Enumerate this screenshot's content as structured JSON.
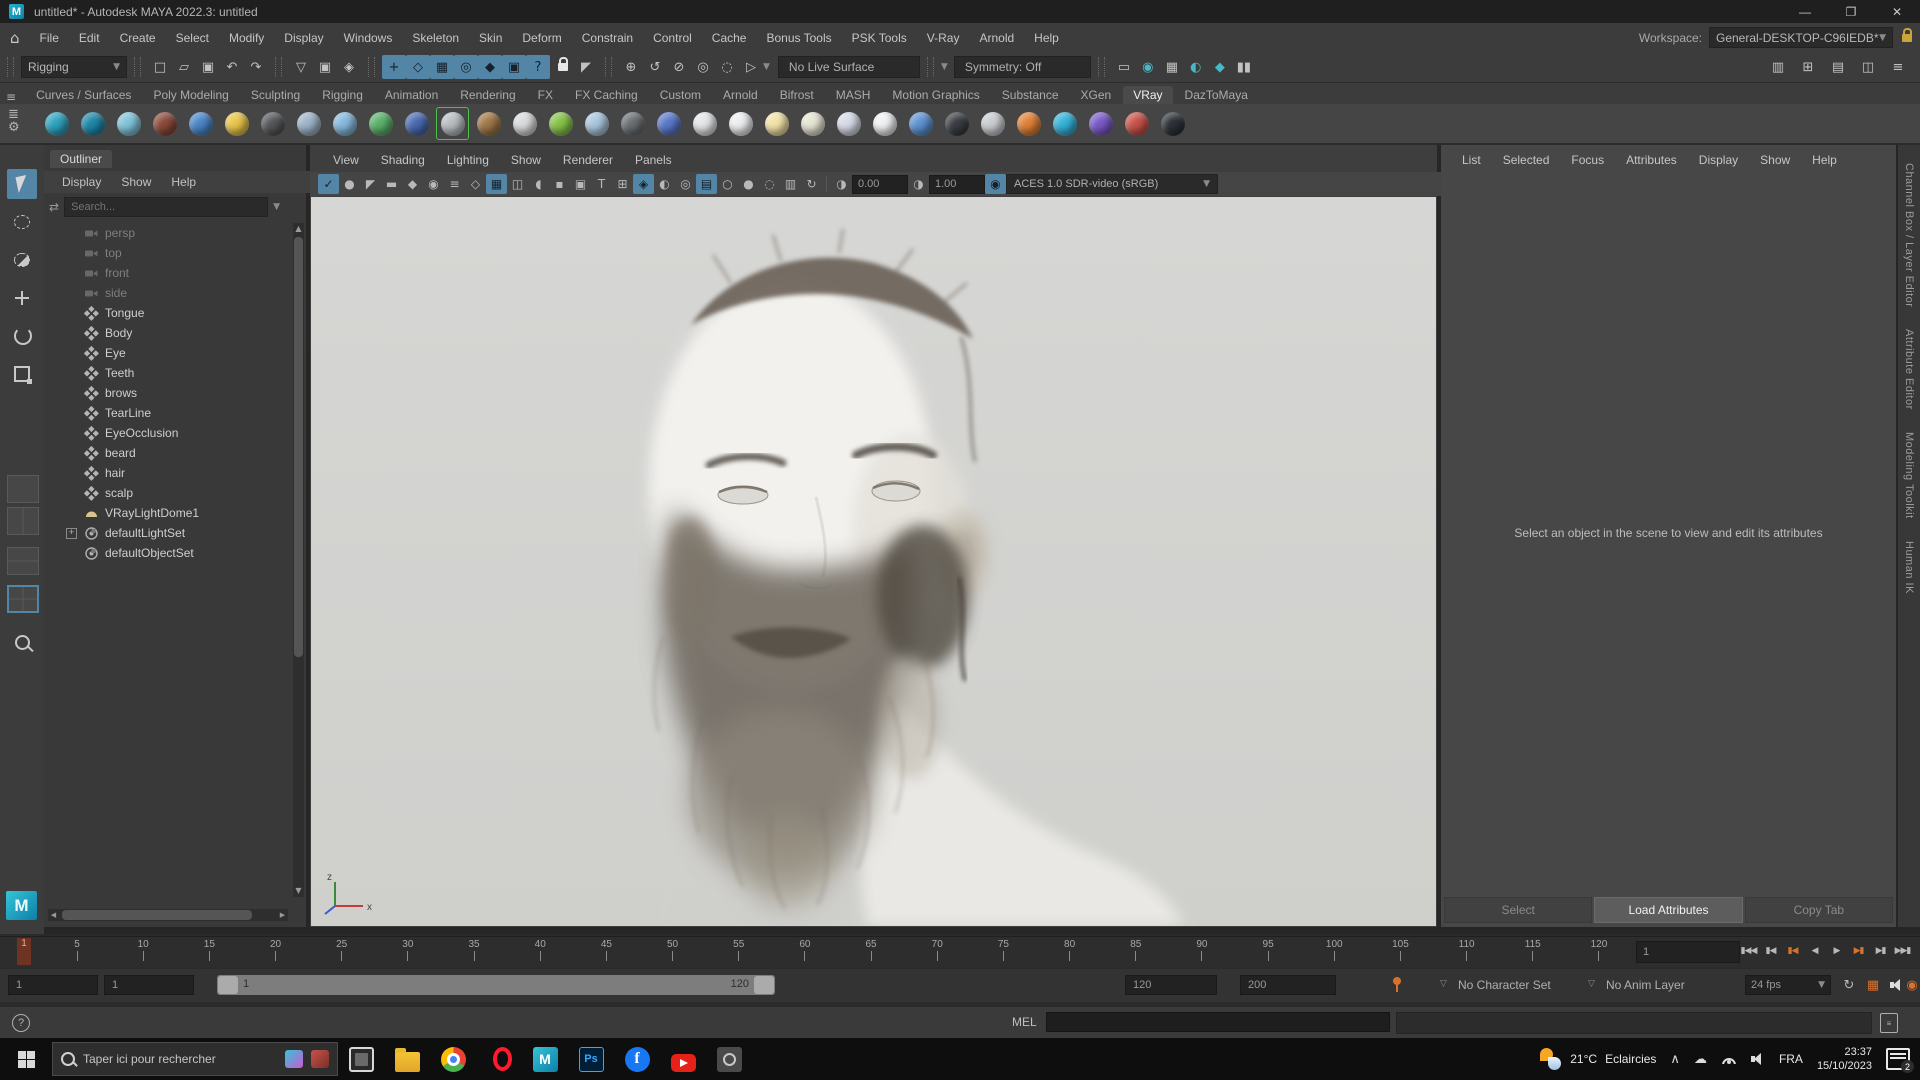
{
  "window": {
    "title": "untitled* - Autodesk MAYA 2022.3: untitled"
  },
  "menu_bar": {
    "items": [
      "File",
      "Edit",
      "Create",
      "Select",
      "Modify",
      "Display",
      "Windows",
      "Skeleton",
      "Skin",
      "Deform",
      "Constrain",
      "Control",
      "Cache",
      "Bonus Tools",
      "PSK Tools",
      "V-Ray",
      "Arnold",
      "Help"
    ],
    "workspace_label": "Workspace:",
    "workspace_value": "General-DESKTOP-C96IEDB*"
  },
  "status_line": {
    "menuset": "Rigging",
    "file_icons": [
      {
        "g": "□",
        "name": "new-scene-icon"
      },
      {
        "g": "▱",
        "name": "open-scene-icon"
      },
      {
        "g": "▣",
        "name": "save-scene-icon"
      },
      {
        "g": "↶",
        "name": "undo-icon"
      },
      {
        "g": "↷",
        "name": "redo-icon"
      }
    ],
    "selection_icons": [
      {
        "g": "▽",
        "name": "select-hierarchy-icon"
      },
      {
        "g": "▣",
        "name": "select-object-icon",
        "on": true
      },
      {
        "g": "◈",
        "name": "select-component-icon"
      }
    ],
    "snap_icons": [
      {
        "g": "+",
        "on": true
      },
      {
        "g": "◇",
        "on": true
      },
      {
        "g": "▦",
        "on": true
      },
      {
        "g": "◎",
        "on": true
      },
      {
        "g": "◆",
        "on": true
      },
      {
        "g": "▣",
        "on": true
      },
      {
        "g": "?",
        "on": true
      }
    ],
    "history_icons": [
      {
        "g": "⊕"
      },
      {
        "g": "↺"
      },
      {
        "g": "⊘"
      },
      {
        "g": "◎"
      },
      {
        "g": "◌"
      },
      {
        "g": "▷"
      }
    ],
    "live_surface": "No Live Surface",
    "symmetry": "Symmetry: Off",
    "render_icons": [
      {
        "g": "▭"
      },
      {
        "g": "◉",
        "teal": true
      },
      {
        "g": "▦"
      },
      {
        "g": "◐",
        "teal": true
      },
      {
        "g": "◆",
        "teal": true
      },
      {
        "g": "▮▮"
      }
    ],
    "sidebar_toggles": [
      {
        "g": "▥"
      },
      {
        "g": "⊞"
      },
      {
        "g": "▤",
        "on": true
      },
      {
        "g": "◫"
      },
      {
        "g": "≡"
      }
    ]
  },
  "shelf": {
    "tabs": [
      {
        "label": "Curves / Surfaces"
      },
      {
        "label": "Poly Modeling"
      },
      {
        "label": "Sculpting"
      },
      {
        "label": "Rigging"
      },
      {
        "label": "Animation"
      },
      {
        "label": "Rendering"
      },
      {
        "label": "FX"
      },
      {
        "label": "FX Caching"
      },
      {
        "label": "Custom"
      },
      {
        "label": "Arnold"
      },
      {
        "label": "Bifrost"
      },
      {
        "label": "MASH"
      },
      {
        "label": "Motion Graphics"
      },
      {
        "label": "Substance"
      },
      {
        "label": "XGen"
      },
      {
        "label": "VRay",
        "active": true
      },
      {
        "label": "DazToMaya"
      }
    ],
    "icons": [
      {
        "name": "vray-node-icon",
        "color": "#2fa3c0"
      },
      {
        "name": "vray-nodes-icon",
        "color": "#1f87a8"
      },
      {
        "name": "vray-panel-icon",
        "color": "#7fc3d8"
      },
      {
        "name": "vray-cube-icon",
        "color": "#8a4a3a"
      },
      {
        "name": "vray-sphere-icon",
        "color": "#4a86c8"
      },
      {
        "name": "vray-lightbulb-icon",
        "color": "#e8c44a"
      },
      {
        "name": "vray-frame-icon",
        "color": "#55575a"
      },
      {
        "name": "vray-gray-sphere-icon",
        "color": "#9db3c8"
      },
      {
        "name": "vray-dome-light-icon",
        "color": "#86b8dc"
      },
      {
        "name": "vray-ies-light-icon",
        "color": "#5ab06a"
      },
      {
        "name": "vray-mesh-light-icon",
        "color": "#4a6ab0"
      },
      {
        "name": "vray-selected-sphere-icon",
        "color": "#b9bdc0",
        "sel": true
      },
      {
        "name": "vray-wood-box-icon",
        "color": "#a07848"
      },
      {
        "name": "vray-wire-sphere-icon",
        "color": "#d8dadc"
      },
      {
        "name": "vray-grass-icon",
        "color": "#86c24a"
      },
      {
        "name": "vray-fur-sphere-icon",
        "color": "#a9c6de"
      },
      {
        "name": "vray-question-icon",
        "color": "#6a6e72"
      },
      {
        "name": "vray-blob-icon",
        "color": "#5a78c8"
      },
      {
        "name": "vray-plane-icon",
        "color": "#e4e6e8"
      },
      {
        "name": "vray-arrow-icon",
        "color": "#eceef0"
      },
      {
        "name": "vray-sun-icon",
        "color": "#f2e2a8"
      },
      {
        "name": "vray-rays-icon",
        "color": "#e6e4d2"
      },
      {
        "name": "vray-fog-icon",
        "color": "#d6dae6"
      },
      {
        "name": "vray-page-icon",
        "color": "#eff1f3"
      },
      {
        "name": "vray-drop-icon",
        "color": "#5e92d2"
      },
      {
        "name": "vray-multi-icon",
        "color": "#3a3e44"
      },
      {
        "name": "vray-checker-icon",
        "color": "#c9ccd0"
      },
      {
        "name": "vray-clipboard-icon",
        "color": "#e08038"
      },
      {
        "name": "vray-monitor-icon",
        "color": "#35b2d9"
      },
      {
        "name": "vray-purple-icon",
        "color": "#7a5ac8"
      },
      {
        "name": "vray-pair-icon",
        "color": "#c8524a"
      },
      {
        "name": "vray-dark-sphere-icon",
        "color": "#2e3238"
      }
    ]
  },
  "toolbox": {
    "tools": [
      {
        "icon": "select",
        "name": "select-tool",
        "active": true
      },
      {
        "icon": "lasso",
        "name": "lasso-tool"
      },
      {
        "icon": "paintsel",
        "name": "paint-select-tool"
      },
      {
        "icon": "move",
        "name": "move-tool"
      },
      {
        "icon": "rotate",
        "name": "rotate-tool"
      },
      {
        "icon": "scale",
        "name": "scale-tool"
      }
    ]
  },
  "outliner": {
    "tab": "Outliner",
    "menus": [
      "Display",
      "Show",
      "Help"
    ],
    "search_placeholder": "Search...",
    "items": [
      {
        "label": "persp",
        "icon": "camera",
        "dim": true
      },
      {
        "label": "top",
        "icon": "camera",
        "dim": true
      },
      {
        "label": "front",
        "icon": "camera",
        "dim": true
      },
      {
        "label": "side",
        "icon": "camera",
        "dim": true
      },
      {
        "label": "Tongue",
        "icon": "mesh"
      },
      {
        "label": "Body",
        "icon": "mesh"
      },
      {
        "label": "Eye",
        "icon": "mesh"
      },
      {
        "label": "Teeth",
        "icon": "mesh"
      },
      {
        "label": "brows",
        "icon": "mesh"
      },
      {
        "label": "TearLine",
        "icon": "mesh"
      },
      {
        "label": "EyeOcclusion",
        "icon": "mesh"
      },
      {
        "label": "beard",
        "icon": "mesh"
      },
      {
        "label": "hair",
        "icon": "mesh"
      },
      {
        "label": "scalp",
        "icon": "mesh"
      },
      {
        "label": "VRayLightDome1",
        "icon": "dome"
      },
      {
        "label": "defaultLightSet",
        "icon": "set",
        "expand": true
      },
      {
        "label": "defaultObjectSet",
        "icon": "set"
      }
    ]
  },
  "viewport": {
    "menus": [
      "View",
      "Shading",
      "Lighting",
      "Show",
      "Renderer",
      "Panels"
    ],
    "toolbar_icons": [
      {
        "g": "✓",
        "on": true
      },
      {
        "g": "●"
      },
      {
        "g": "◤"
      },
      {
        "g": "▬"
      },
      {
        "g": "◆"
      },
      {
        "g": "◉"
      },
      {
        "g": "≡"
      },
      {
        "g": "◇"
      },
      {
        "g": "▦",
        "on": true
      },
      {
        "g": "◫"
      },
      {
        "g": "◖"
      },
      {
        "g": "▪"
      },
      {
        "g": "▣"
      },
      {
        "g": "T"
      },
      {
        "g": "⊞"
      },
      {
        "g": "◈",
        "on": true
      },
      {
        "g": "◐"
      },
      {
        "g": "◎"
      },
      {
        "g": "▤",
        "on": true
      },
      {
        "g": "○"
      },
      {
        "g": "●"
      },
      {
        "g": "◌"
      },
      {
        "g": "▥"
      },
      {
        "g": "↻"
      }
    ],
    "exposure": "0.00",
    "gamma": "1.00",
    "colorspace": "ACES 1.0 SDR-video (sRGB)",
    "axis_x_label": "x",
    "axis_z_label": "z"
  },
  "attribute_editor": {
    "menus": [
      "List",
      "Selected",
      "Focus",
      "Attributes",
      "Display",
      "Show",
      "Help"
    ],
    "message": "Select an object in the scene to view and edit its attributes",
    "buttons": [
      {
        "label": "Select",
        "dim": true
      },
      {
        "label": "Load Attributes",
        "primary": true
      },
      {
        "label": "Copy Tab",
        "dim": true
      }
    ]
  },
  "side_tabs": [
    "Channel Box / Layer Editor",
    "Attribute Editor",
    "Modeling Toolkit",
    "Human IK"
  ],
  "time_slider": {
    "ticks": [
      "5",
      "10",
      "15",
      "20",
      "25",
      "30",
      "35",
      "40",
      "45",
      "50",
      "55",
      "60",
      "65",
      "70",
      "75",
      "80",
      "85",
      "90",
      "95",
      "100",
      "105",
      "110",
      "115",
      "120"
    ],
    "playhead_frame": "1",
    "current_frame": "1",
    "playback_buttons": [
      {
        "glyph": "▮◀◀",
        "name": "go-to-start-button"
      },
      {
        "glyph": "▮◀",
        "name": "step-back-frame-button"
      },
      {
        "glyph": "▮◀",
        "name": "step-back-key-button",
        "key": true
      },
      {
        "glyph": "◀",
        "name": "play-backwards-button"
      },
      {
        "glyph": "▶",
        "name": "play-forwards-button"
      },
      {
        "glyph": "▶▮",
        "name": "step-forward-key-button",
        "key": true
      },
      {
        "glyph": "▶▮",
        "name": "step-forward-frame-button"
      },
      {
        "glyph": "▶▶▮",
        "name": "go-to-end-button"
      }
    ]
  },
  "range_slider": {
    "animation_start": "1",
    "playback_start": "1",
    "range_start_label": "1",
    "range_end_label": "120",
    "playback_end": "120",
    "animation_end": "200",
    "character_set": "No Character Set",
    "anim_layer": "No Anim Layer",
    "fps": "24 fps"
  },
  "command_line": {
    "label": "MEL"
  },
  "taskbar": {
    "search_placeholder": "Taper ici pour rechercher",
    "apps": [
      {
        "icon": "taskview"
      },
      {
        "icon": "explorer"
      },
      {
        "icon": "chrome"
      },
      {
        "icon": "opera"
      },
      {
        "icon": "maya"
      },
      {
        "icon": "photoshop"
      },
      {
        "icon": "facebook"
      },
      {
        "icon": "youtube"
      },
      {
        "icon": "screenshot"
      }
    ],
    "weather_temp": "21°C",
    "weather_desc": "Eclaircies",
    "language": "FRA",
    "time": "23:37",
    "date": "15/10/2023",
    "notification_count": "2"
  },
  "colors": {
    "accent_blue": "#5285a6",
    "accent_orange": "#d7722c",
    "viewport_bg": "#d2d2d0"
  }
}
